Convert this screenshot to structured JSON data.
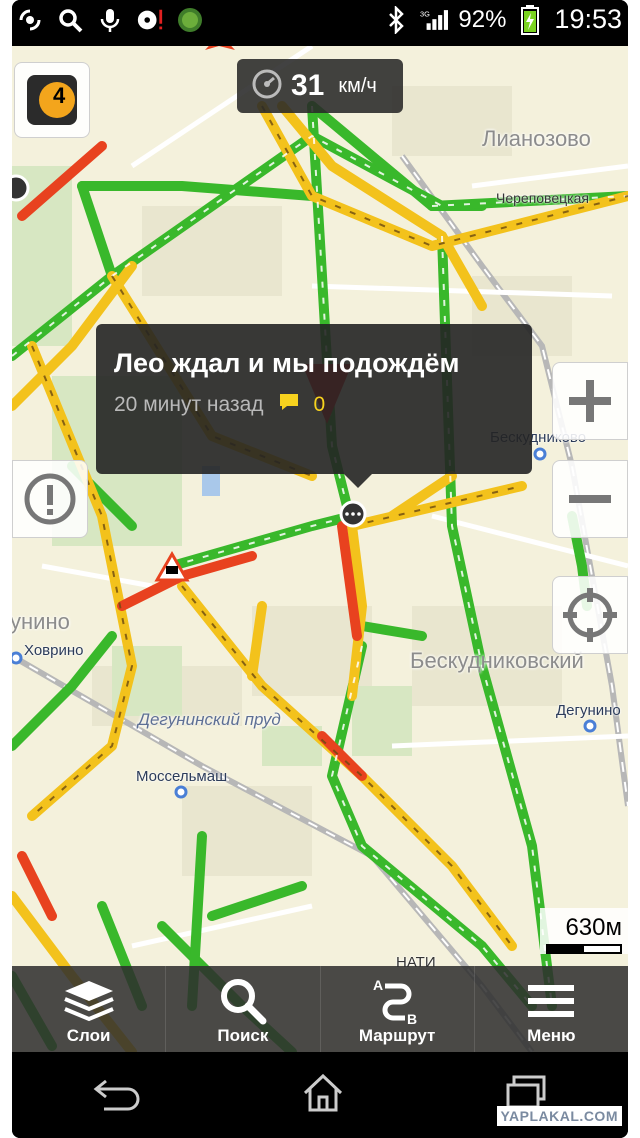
{
  "status_bar": {
    "battery": "92%",
    "time": "19:53",
    "left_icons": [
      "signal-wave-icon",
      "search-icon",
      "mic-icon",
      "disc-warning-icon",
      "android-icon"
    ],
    "right_icons": [
      "bluetooth-icon",
      "cell-signal-icon",
      "battery-charging-icon"
    ]
  },
  "speed": {
    "value": "31",
    "unit": "км/ч"
  },
  "traffic_level": "4",
  "popup": {
    "title": "Лео ждал и мы подождём",
    "time_ago": "20 минут назад",
    "comments": "0"
  },
  "places": {
    "lianozovo": "Лианозово",
    "beskudnikovsky": "Бескудниковский",
    "beskudnikovo_station": "Бескудниково",
    "degunino_station": "Дегунино",
    "khovrino_station": "Ховрино",
    "mosselmash_station": "Моссельмаш",
    "degunino_pond": "Дегунинский пруд",
    "unino": "унино",
    "cherepovetskaya": "Череповецкая",
    "nati": "НАТИ"
  },
  "scale": "630м",
  "toolbar": {
    "layers": "Слои",
    "search": "Поиск",
    "route": "Маршрут",
    "menu": "Меню"
  },
  "watermark": "YAPLAKAL.COM",
  "colors": {
    "traffic_green": "#39b82b",
    "traffic_yellow": "#f3c21c",
    "traffic_red": "#e8421f",
    "map_bg": "#f4f1dc",
    "popup_accent": "#f7d21e"
  }
}
